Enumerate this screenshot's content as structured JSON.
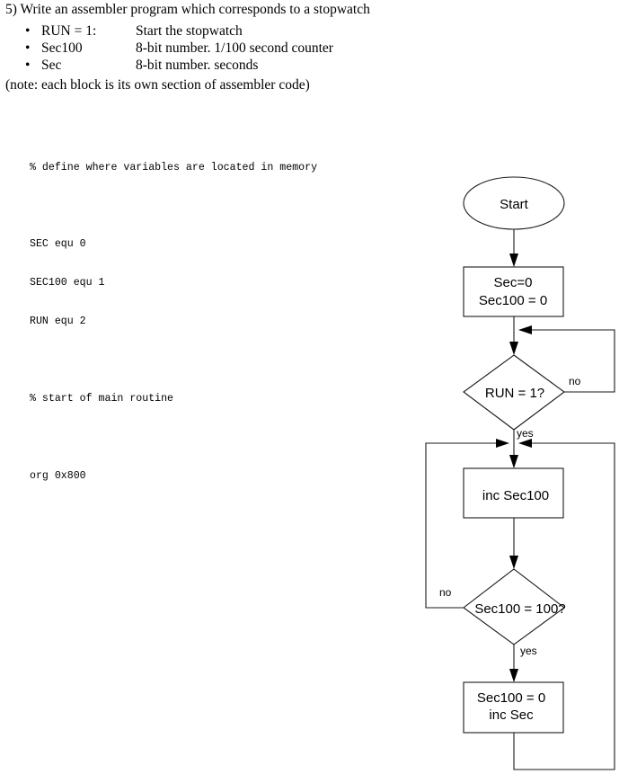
{
  "question": {
    "title": "5) Write an assembler program which corresponds to a stopwatch",
    "bullets": [
      {
        "term": "RUN = 1:",
        "description": "Start the stopwatch"
      },
      {
        "term": "Sec100",
        "description": "8-bit number.  1/100 second counter"
      },
      {
        "term": "Sec",
        "description": "8-bit number.  seconds"
      }
    ],
    "note": "(note:  each block is its own section of assembler code)"
  },
  "code": {
    "lines": [
      "% define where variables are located in memory",
      "",
      "SEC equ 0",
      "SEC100 equ 1",
      "RUN equ 2",
      "",
      "% start of main routine",
      "",
      "org 0x800"
    ]
  },
  "flowchart": {
    "start": "Start",
    "init": [
      "Sec=0",
      "Sec100 = 0"
    ],
    "decision_run": "RUN = 1?",
    "run_no": "no",
    "run_yes": "yes",
    "inc_sec100": "inc Sec100",
    "decision_sec100": "Sec100 = 100?",
    "sec100_no": "no",
    "sec100_yes": "yes",
    "reset": [
      "Sec100 = 0",
      "inc Sec"
    ]
  }
}
